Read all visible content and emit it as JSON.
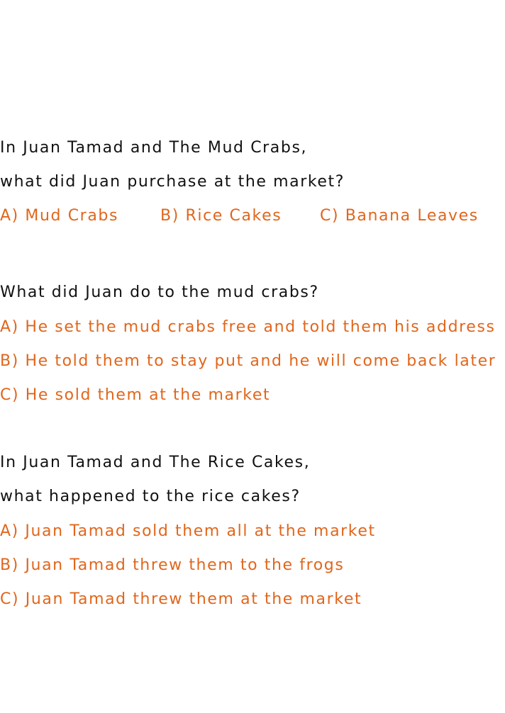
{
  "questions": [
    {
      "prompt_lines": [
        "In Juan Tamad and The Mud Crabs,",
        "what did Juan purchase at the market?"
      ],
      "options": [
        "A) Mud Crabs",
        "B) Rice Cakes",
        "C) Banana Leaves"
      ]
    },
    {
      "prompt_lines": [
        "What did Juan do to the mud crabs?"
      ],
      "options": [
        "A) He set the mud crabs free and told them his address",
        "B) He told them to stay put and he will come back later",
        "C) He sold them at the market"
      ]
    },
    {
      "prompt_lines": [
        "In Juan Tamad and The Rice Cakes,",
        "what happened to the rice cakes?"
      ],
      "options": [
        "A) Juan Tamad sold them all at the market",
        "B) Juan Tamad threw them to the frogs",
        "C) Juan Tamad threw them at the market"
      ]
    }
  ],
  "colors": {
    "question_text": "#111111",
    "option_text": "#e0661c",
    "background": "#ffffff"
  }
}
